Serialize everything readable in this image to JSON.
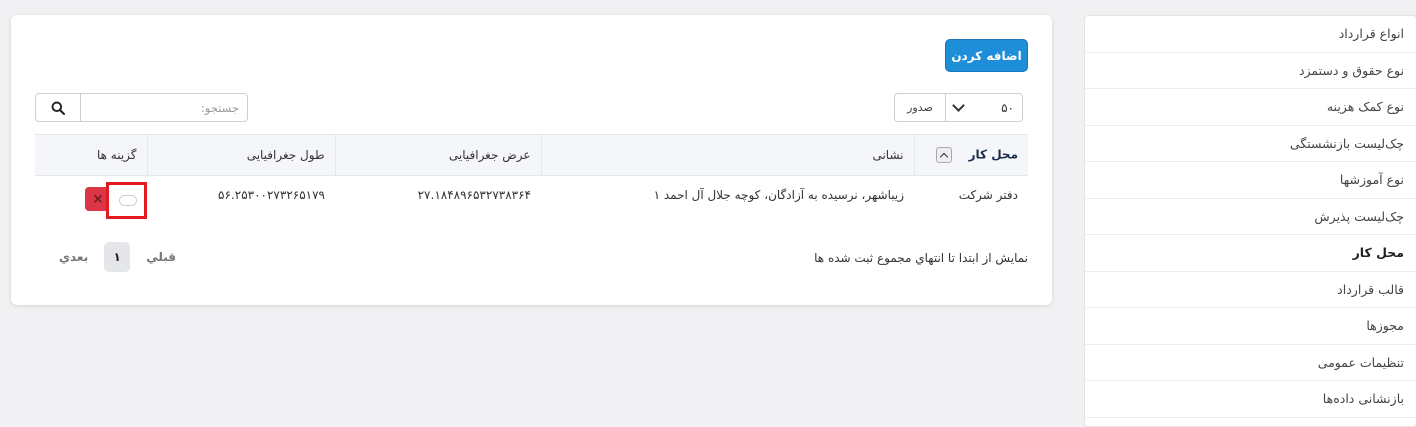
{
  "sidebar": {
    "items": [
      {
        "label": "انواع قرارداد"
      },
      {
        "label": "نوع حقوق و دستمزد"
      },
      {
        "label": "نوع کمک هزینه"
      },
      {
        "label": "چک‌لیست بازنشستگی"
      },
      {
        "label": "نوع آموزشها"
      },
      {
        "label": "چک‌لیست پذیرش"
      },
      {
        "label": "محل کار",
        "active": true
      },
      {
        "label": "قالب قرارداد"
      },
      {
        "label": "مجوزها"
      },
      {
        "label": "تنظیمات عمومی"
      },
      {
        "label": "بازنشانی داده‌ها"
      }
    ]
  },
  "toolbar": {
    "add_label": "اضافه کردن",
    "pagesize_value": "۵۰",
    "export_label": "صدور",
    "search_placeholder": "جستجو:"
  },
  "table": {
    "columns": [
      "محل کار",
      "نشانی",
      "عرض جغرافیایی",
      "طول جغرافیایی",
      "گزینه ها"
    ],
    "rows": [
      [
        "دفتر شرکت",
        "زیباشهر، نرسیده به آزادگان، کوچه جلال آل احمد ۱",
        "۲۷.۱۸۴۸۹۶۵۳۲۷۳۸۳۶۴",
        "۵۶.۲۵۳۰۰۲۷۳۲۶۵۱۷۹"
      ]
    ]
  },
  "footer": {
    "info": "نمایش از ابتدا تا انتهاي مجموع ثبت شده ها",
    "prev": "قبلي",
    "page": "۱",
    "next": "بعدي"
  },
  "colors": {
    "primary": "#1f8ed9",
    "danger": "#dc3545",
    "highlight": "#e21b23"
  },
  "icons": {
    "search": "search-icon",
    "sort": "chevron-up-icon",
    "select": "chevron-down-icon",
    "delete": "close-icon"
  }
}
